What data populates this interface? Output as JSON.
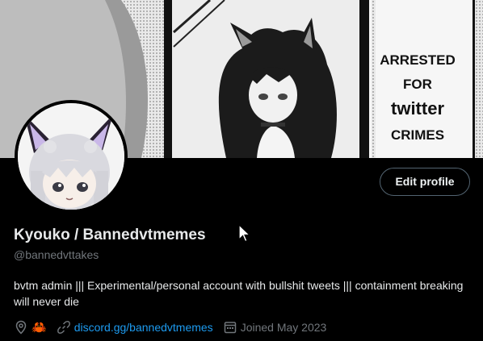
{
  "banner": {
    "caption_lines": [
      "ARRESTED",
      "FOR",
      "twitter",
      "CRIMES"
    ]
  },
  "profile": {
    "display_name": "Kyouko / Bannedvtmemes",
    "handle": "@bannedvttakes",
    "bio": "bvtm admin ||| Experimental/personal account with bullshit tweets ||| containment breaking will never die",
    "location_emoji": "🦀",
    "link": "discord.gg/bannedvtmemes",
    "joined": "Joined May 2023"
  },
  "actions": {
    "edit_profile_label": "Edit profile"
  },
  "colors": {
    "background": "#000000",
    "text_primary": "#e7e9ea",
    "text_secondary": "#71767b",
    "link": "#1d9bf0",
    "button_border": "#536471"
  },
  "icons": [
    "location-icon",
    "link-icon",
    "calendar-icon",
    "mouse-cursor-icon"
  ]
}
